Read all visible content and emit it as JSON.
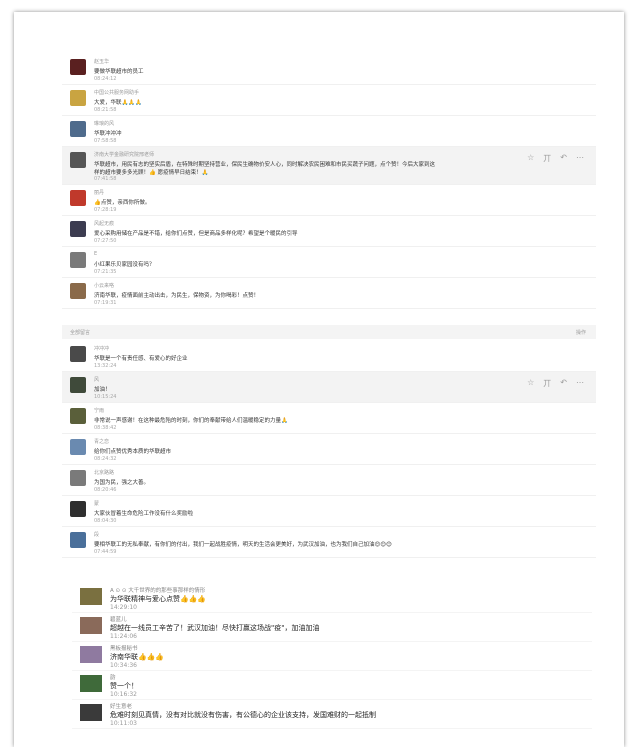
{
  "section1": {
    "comments": [
      {
        "name": "赵玉华",
        "text": "要做华联超市的员工",
        "time": "08:24:12",
        "avatar_color": "#5a2020"
      },
      {
        "name": "中国公共服务网助手",
        "text": "大爱，华联🙏🙏🙏",
        "time": "08:21:58",
        "avatar_color": "#c9a441"
      },
      {
        "name": "琳琅的风",
        "text": "华联冲冲冲",
        "time": "07:58:58",
        "avatar_color": "#4f6b8c"
      },
      {
        "name": "济南大学金融研究院邢老师",
        "text": "华联超市，用民有志的坚实后盾，在特殊时期坚持营业，保民生确物价安人心，同时解决农民困难和市民买蔬子问题，点个赞！今后大家到这",
        "text2": "样的超市要多多光顾！👍 愿疫情早日结束！🙏",
        "time": "07:41:58",
        "avatar_color": "#555555",
        "highlight": true,
        "actions": [
          "☆",
          "丌",
          "↶",
          "⋯"
        ]
      },
      {
        "name": "丽丹",
        "text": "👍点赞，亲西你所做。",
        "time": "07:28:19",
        "avatar_color": "#c0392b"
      },
      {
        "name": "风起无痕",
        "text": "爱心采购用储在产品是不错，给你们点赞，但是商品多样化呢？希望是个暖民的引导",
        "time": "07:27:50",
        "avatar_color": "#3c3c50"
      },
      {
        "name": "E",
        "text": "小红果乐贝家园没有吗？",
        "time": "07:21:35",
        "avatar_color": "#7a7a7a"
      },
      {
        "name": "小云来咯",
        "text": "济南华联，疫情面前主动出击，为民生，保物资，为你喝彩！点赞！",
        "time": "07:19:31",
        "avatar_color": "#8a6a4a"
      }
    ]
  },
  "section2": {
    "title": "全部留言",
    "op": "操作",
    "comments": [
      {
        "name": "冲冲冲",
        "text": "华联是一个有责任感、有爱心的好企业",
        "time": "13:32:24",
        "avatar_color": "#4a4a4a"
      },
      {
        "name": "风",
        "text": "加油！",
        "time": "10:15:24",
        "avatar_color": "#3f4a3a",
        "highlight": true,
        "actions": [
          "☆",
          "丌",
          "↶",
          "⋯"
        ]
      },
      {
        "name": "宁雨",
        "text": "非常说一声感谢！在这种最危殆的时刻，你们的奉献带给人们温暖稳定的力量🙏",
        "time": "08:38:42",
        "avatar_color": "#5a5f3a"
      },
      {
        "name": "青之恋",
        "text": "给你们点赞优秀本质的华联超市",
        "time": "08:24:32",
        "avatar_color": "#6a8ab0"
      },
      {
        "name": "北京路路",
        "text": "为国为民，强之大善。",
        "time": "08:20:46",
        "avatar_color": "#7a7a7a"
      },
      {
        "name": "蒙",
        "text": "大家伙冒着生命危险工作没有什么奖励啦",
        "time": "08:04:30",
        "avatar_color": "#2f2f2f"
      },
      {
        "name": "段",
        "text": "要相华联工的无私奉献，有你们的付出，我们一起战胜疫情，明天的生活会更美好，为武汉加油，也为我们自己加油😊😊😊",
        "time": "07:44:59",
        "avatar_color": "#4a6f9a"
      }
    ]
  },
  "section3": {
    "comments": [
      {
        "name": "A  ⊙ ⊙  大千世界的的那些事那样的情形",
        "text": "为华联精神与爱心点赞👍👍👍",
        "time": "14:29:10",
        "avatar_color": "#7a7040"
      },
      {
        "name": "碧蓝儿",
        "text": "超越在一线员工辛苦了！武汉加油！尽快打赢这场战\"疫\"，加油加油",
        "time": "11:24:06",
        "avatar_color": "#8a6a5a"
      },
      {
        "name": "黑板报秘书",
        "text": "济南华联👍👍👍",
        "time": "10:34:36",
        "avatar_color": "#8f7aa0"
      },
      {
        "name": "韵",
        "text": "赞一个！",
        "time": "10:16:32",
        "avatar_color": "#3f6a3a"
      },
      {
        "name": "好生意老",
        "text": "危难时刻见真情，没有对比就没有伤害，有公德心的企业该支持，发国难财的一起抵制",
        "time": "10:11:03",
        "avatar_color": "#3a3a3a"
      }
    ]
  }
}
